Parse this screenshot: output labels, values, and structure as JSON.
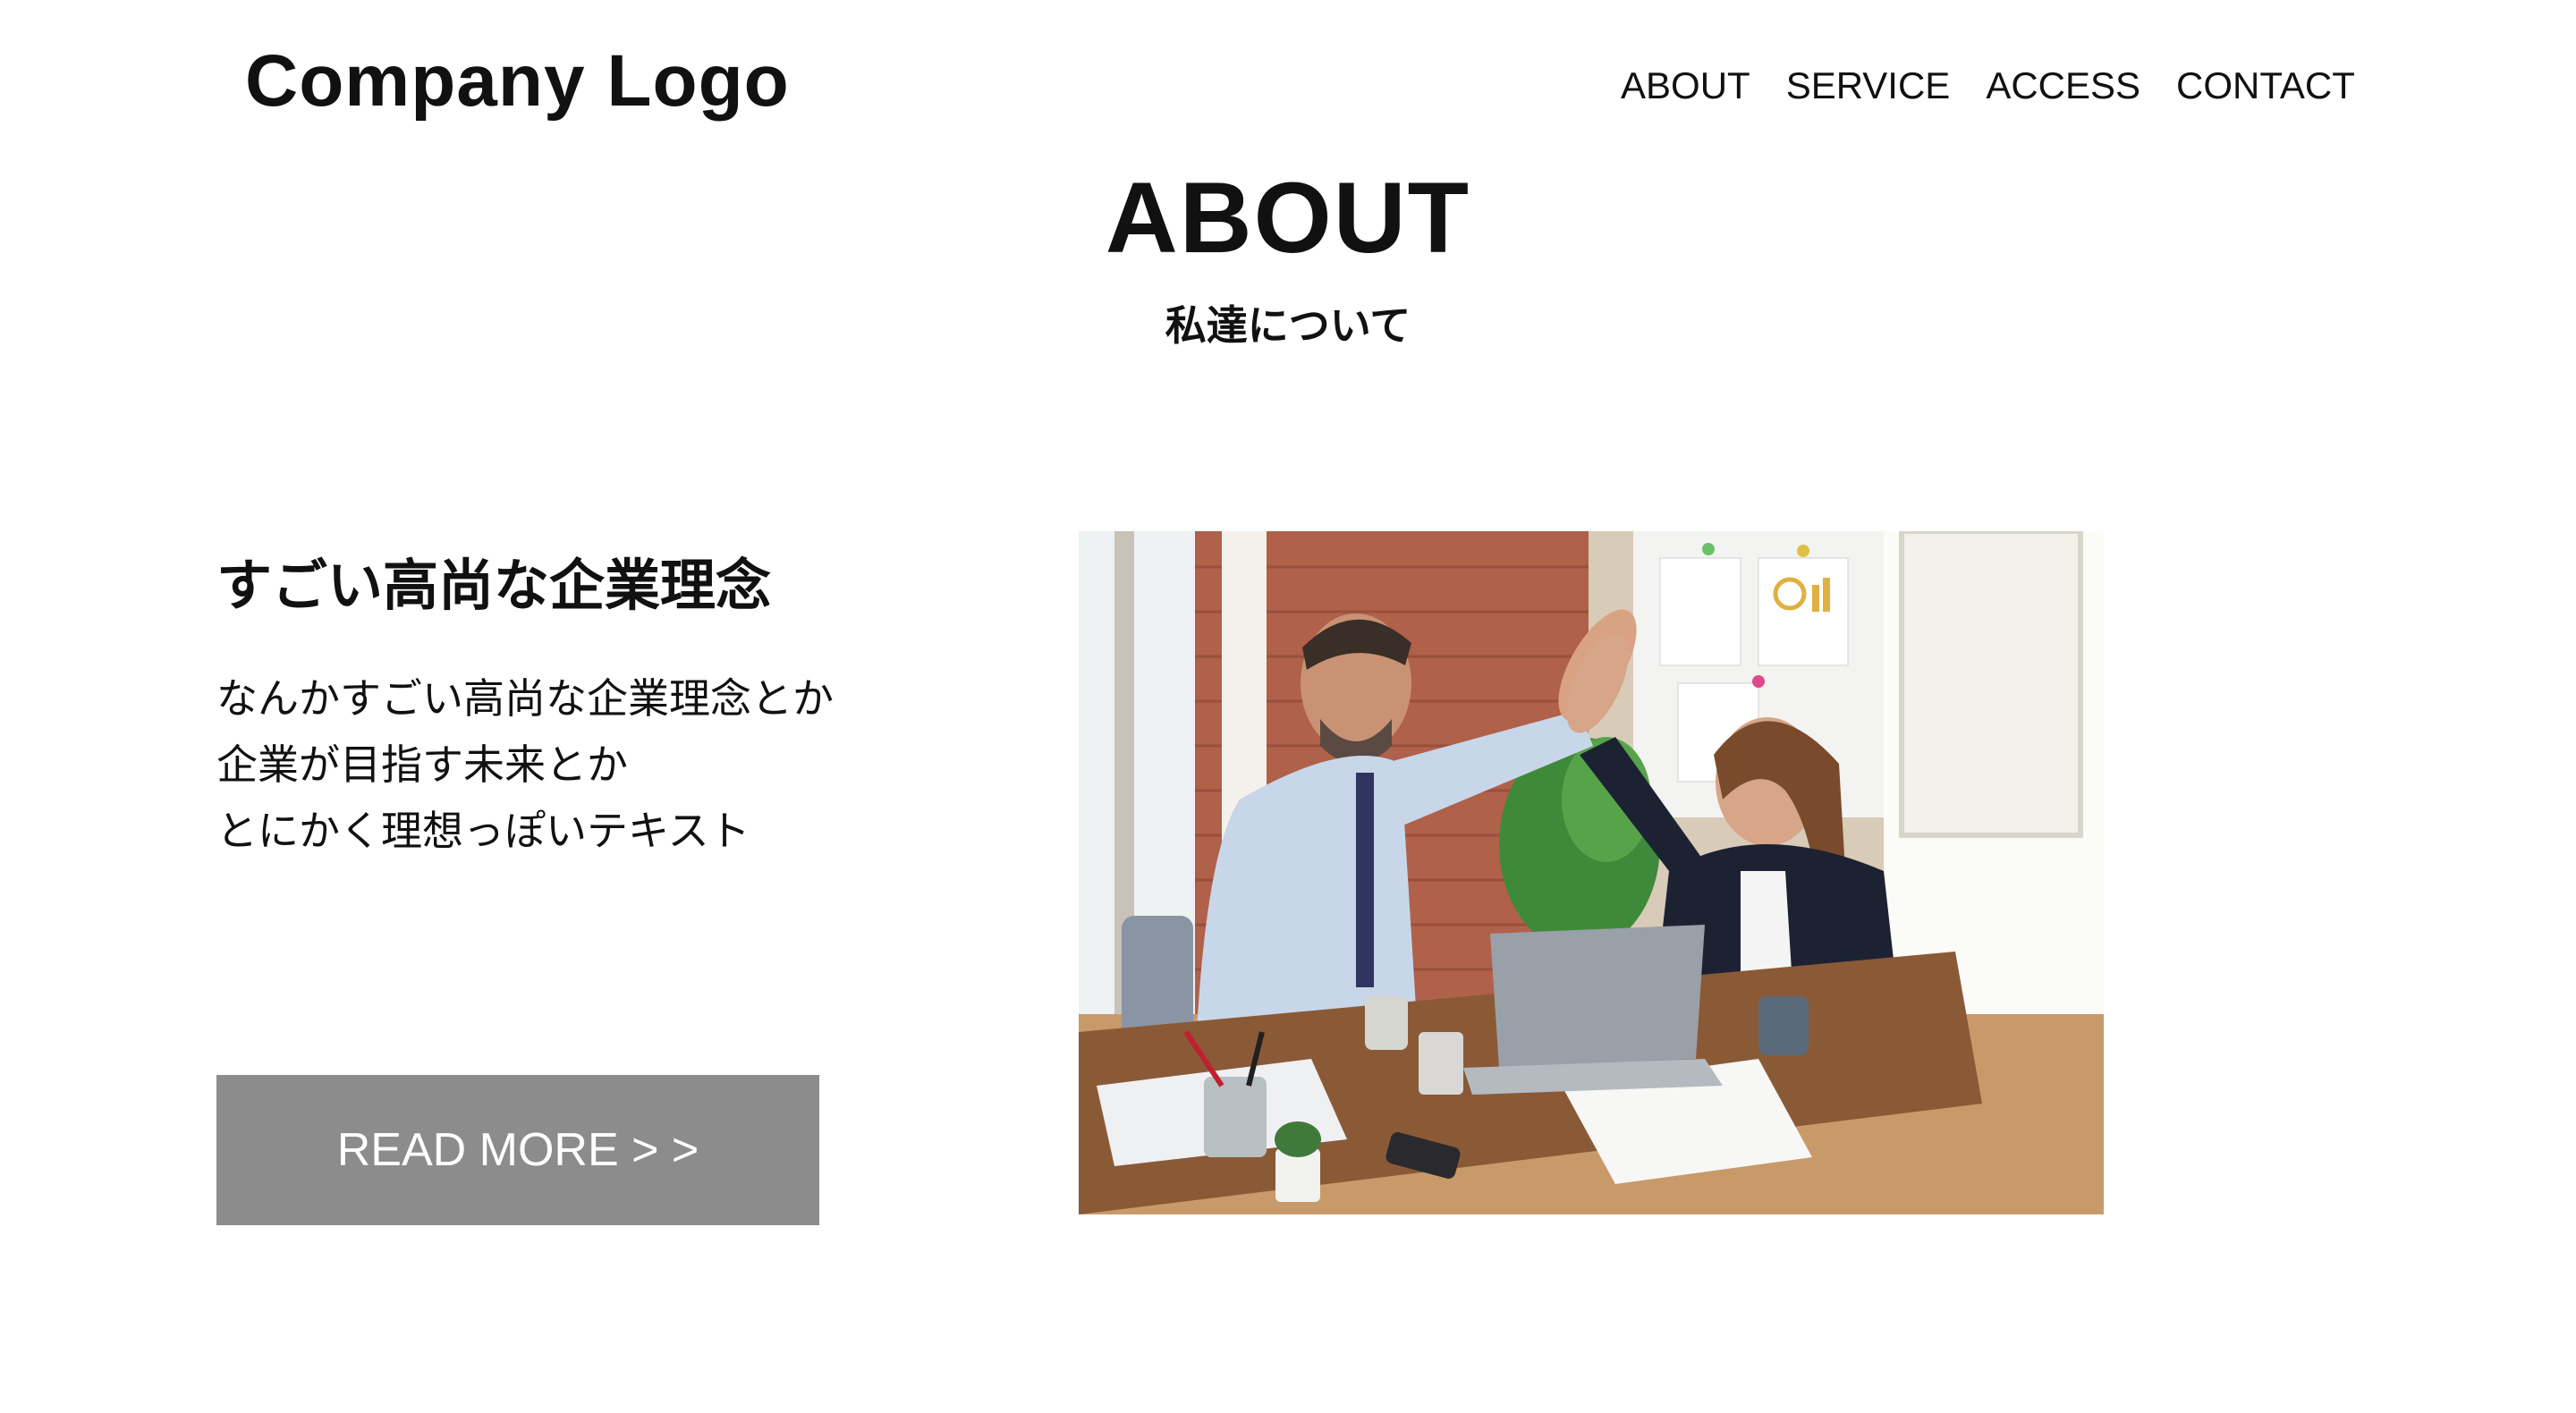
{
  "header": {
    "logo": "Company Logo",
    "nav": [
      "ABOUT",
      "SERVICE",
      "ACCESS",
      "CONTACT"
    ]
  },
  "section": {
    "title": "ABOUT",
    "subtitle": "私達について"
  },
  "content": {
    "heading": "すごい高尚な企業理念",
    "lines": [
      "なんかすごい高尚な企業理念とか",
      "企業が目指す未来とか",
      "とにかく理想っぽいテキスト"
    ],
    "button_label": "READ MORE > >"
  },
  "photo": {
    "icon": "office-high-five-photo"
  },
  "colors": {
    "button_bg": "#8c8c8c",
    "text": "#111111",
    "background": "#ffffff"
  }
}
